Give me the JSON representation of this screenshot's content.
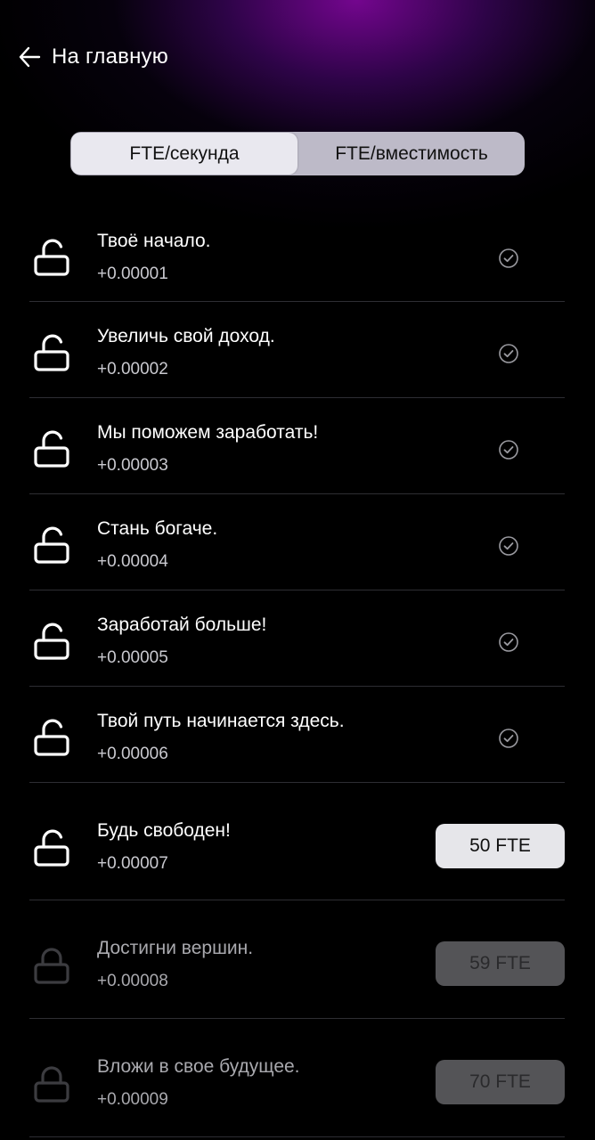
{
  "header": {
    "back_label": "На главную"
  },
  "tabs": [
    {
      "label": "FTE/секунда",
      "active": true
    },
    {
      "label": "FTE/вместимость",
      "active": false
    }
  ],
  "upgrades": [
    {
      "title": "Твоё начало.",
      "value": "+0.00001",
      "state": "unlocked",
      "status": "done"
    },
    {
      "title": "Увеличь свой доход.",
      "value": "+0.00002",
      "state": "unlocked",
      "status": "done"
    },
    {
      "title": "Мы поможем заработать!",
      "value": "+0.00003",
      "state": "unlocked",
      "status": "done"
    },
    {
      "title": "Стань богаче.",
      "value": "+0.00004",
      "state": "unlocked",
      "status": "done"
    },
    {
      "title": "Заработай больше!",
      "value": "+0.00005",
      "state": "unlocked",
      "status": "done"
    },
    {
      "title": "Твой путь начинается здесь.",
      "value": "+0.00006",
      "state": "unlocked",
      "status": "done"
    },
    {
      "title": "Будь свободен!",
      "value": "+0.00007",
      "state": "unlocked",
      "status": "buy",
      "price": "50 FTE"
    },
    {
      "title": "Достигни вершин.",
      "value": "+0.00008",
      "state": "locked",
      "status": "buy",
      "price": "59 FTE"
    },
    {
      "title": "Вложи в свое будущее.",
      "value": "+0.00009",
      "state": "locked",
      "status": "buy",
      "price": "70 FTE"
    }
  ],
  "colors": {
    "accent_glow": "#7a0696",
    "button_active": "#e6e6ea",
    "button_disabled": "#545457",
    "divider": "#2e2e33"
  }
}
